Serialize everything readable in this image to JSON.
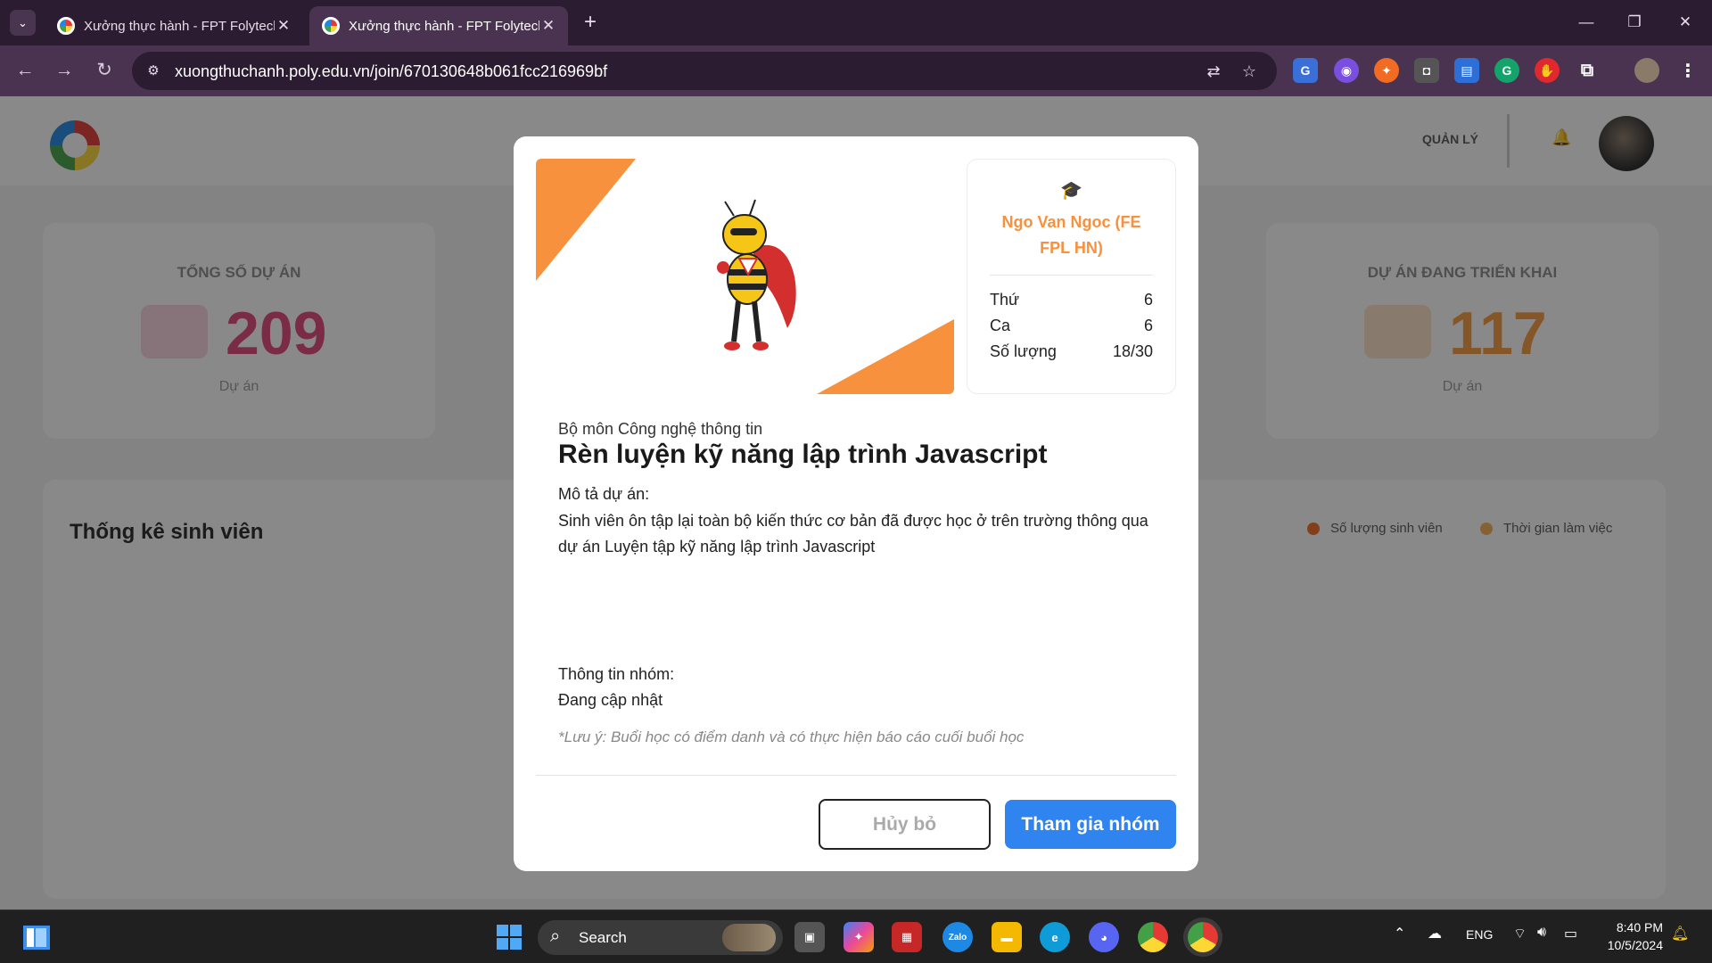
{
  "browser": {
    "tabs": [
      {
        "title": "Xưởng thực hành - FPT Folytech",
        "active": false
      },
      {
        "title": "Xưởng thực hành - FPT Folytech",
        "active": true
      }
    ],
    "url": "xuongthuchanh.poly.edu.vn/join/670130648b061fcc216969bf"
  },
  "background": {
    "stats": [
      {
        "label": "TỔNG SỐ DỰ ÁN",
        "value": "209",
        "unit": "Dự án",
        "color": "#e0447a"
      },
      {
        "label": "DỰ ÁN ĐANG TRIỂN KHAI",
        "value": "117",
        "unit": "Dự án",
        "color": "#f79a3d"
      }
    ],
    "chart_title": "Thống kê sinh viên",
    "legend": [
      "Số lượng sinh viên",
      "Thời gian làm việc"
    ]
  },
  "modal": {
    "teacher": "Ngo Van Ngoc (FE FPL HN)",
    "info": [
      {
        "label": "Thứ",
        "value": "6"
      },
      {
        "label": "Ca",
        "value": "6"
      },
      {
        "label": "Số lượng",
        "value": "18/30"
      }
    ],
    "department": "Bộ môn Công nghệ thông tin",
    "title": "Rèn luyện kỹ năng lập trình Javascript",
    "description_label": "Mô tả dự án:",
    "description": "Sinh viên ôn tập lại toàn bộ kiến thức cơ bản đã được học ở trên trường thông qua dự án Luyện tập kỹ năng lập trình Javascript",
    "group_label": "Thông tin nhóm:",
    "group_value": "Đang cập nhật",
    "note": "*Lưu ý: Buổi học có điểm danh và có thực hiện báo cáo cuối buổi học",
    "cancel_label": "Hủy bỏ",
    "join_label": "Tham gia nhóm",
    "accent_color": "#f7913d",
    "button_color": "#2f84ef"
  },
  "taskbar": {
    "search_label": "Search",
    "language": "ENG",
    "time": "8:40 PM",
    "date": "10/5/2024"
  }
}
